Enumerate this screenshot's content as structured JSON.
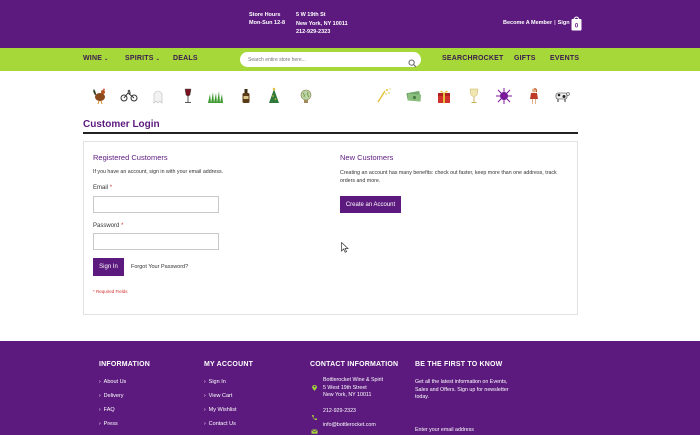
{
  "header": {
    "store_hours_label": "Store Hours",
    "store_hours_value": "Mon-Sun 12-8",
    "address_line1": "5 W 19th St",
    "address_line2": "New York, NY 10011",
    "phone": "212-929-2323",
    "become_member": "Become A Member",
    "separator": "|",
    "sign_in": "Sign In",
    "cart_count": "0"
  },
  "nav": {
    "wine": "WINE",
    "spirits": "SPIRITS",
    "deals": "DEALS",
    "search_placeholder": "Search entire store here...",
    "searchrocket": "SEARCHROCKET",
    "gifts": "GIFTS",
    "events": "EVENTS"
  },
  "category_icons": [
    "rooster-icon",
    "bike-icon",
    "ghost-icon",
    "wine-glass-icon",
    "grass-icon",
    "bottle-icon",
    "party-hat-icon",
    "globe-icon",
    "confetti-icon",
    "money-icon",
    "gift-icon",
    "trophy-icon",
    "urchin-icon",
    "girl-icon",
    "cow-icon"
  ],
  "page": {
    "title": "Customer Login"
  },
  "registered": {
    "title": "Registered Customers",
    "description": "If you have an account, sign in with your email address.",
    "email_label": "Email",
    "password_label": "Password",
    "required_mark": "*",
    "sign_in_button": "Sign In",
    "forgot_link": "Forgot Your Password?",
    "required_note": "* Required Fields"
  },
  "new_customers": {
    "title": "New Customers",
    "description": "Creating an account has many benefits: check out faster, keep more than one address, track orders and more.",
    "create_button": "Create an Account"
  },
  "footer": {
    "information": {
      "heading": "INFORMATION",
      "links": [
        "About Us",
        "Delivery",
        "FAQ",
        "Press"
      ]
    },
    "my_account": {
      "heading": "MY ACCOUNT",
      "links": [
        "Sign In",
        "View Cart",
        "My Wishlist",
        "Contact Us"
      ]
    },
    "contact": {
      "heading": "CONTACT INFORMATION",
      "address_name": "Bottlerocket Wine & Spirit",
      "address_street": "5 West 19th Street",
      "address_city": "New York, NY 10011",
      "phone": "212-929-2323",
      "email": "info@bottlerocket.com"
    },
    "newsletter": {
      "heading": "BE THE FIRST TO KNOW",
      "text": "Get all the latest information on Events, Sales and Offers. Sign up for newsletter today.",
      "email_placeholder": "Enter your email address"
    }
  },
  "colors": {
    "brand_purple": "#5c1a7e",
    "nav_green": "#a7d83a",
    "required_red": "#d0312d"
  }
}
